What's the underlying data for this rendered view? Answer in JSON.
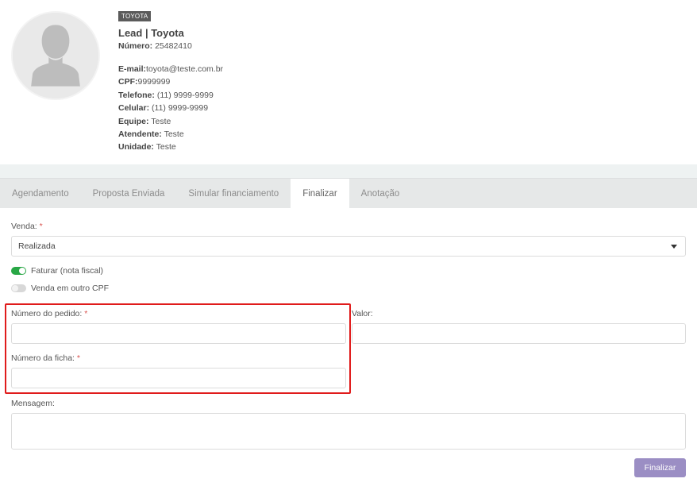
{
  "profile": {
    "brand_badge": "TOYOTA",
    "title": "Lead | Toyota",
    "number_label": "Número:",
    "number_value": "25482410",
    "info": [
      {
        "label": "E-mail:",
        "value": "toyota@teste.com.br"
      },
      {
        "label": "CPF:",
        "value": "9999999"
      },
      {
        "label": "Telefone:",
        "value": "(11) 9999-9999"
      },
      {
        "label": "Celular:",
        "value": "(11) 9999-9999"
      },
      {
        "label": "Equipe:",
        "value": "Teste"
      },
      {
        "label": "Atendente:",
        "value": "Teste"
      },
      {
        "label": "Unidade:",
        "value": "Teste"
      }
    ]
  },
  "tabs": [
    {
      "label": "Agendamento",
      "active": false
    },
    {
      "label": "Proposta Enviada",
      "active": false
    },
    {
      "label": "Simular financiamento",
      "active": false
    },
    {
      "label": "Finalizar",
      "active": true
    },
    {
      "label": "Anotação",
      "active": false
    }
  ],
  "form": {
    "venda_label": "Venda:",
    "venda_value": "Realizada",
    "required_mark": "*",
    "toggle_faturar": {
      "label": "Faturar (nota fiscal)",
      "on": true
    },
    "toggle_outro_cpf": {
      "label": "Venda em outro CPF",
      "on": false
    },
    "numero_pedido_label": "Número do pedido:",
    "valor_label": "Valor:",
    "numero_ficha_label": "Número da ficha:",
    "mensagem_label": "Mensagem:",
    "submit_label": "Finalizar"
  },
  "colors": {
    "accent_button": "#9b8ec4",
    "toggle_on": "#28a745",
    "highlight_box": "#e01b1b",
    "required": "#d9534f"
  }
}
